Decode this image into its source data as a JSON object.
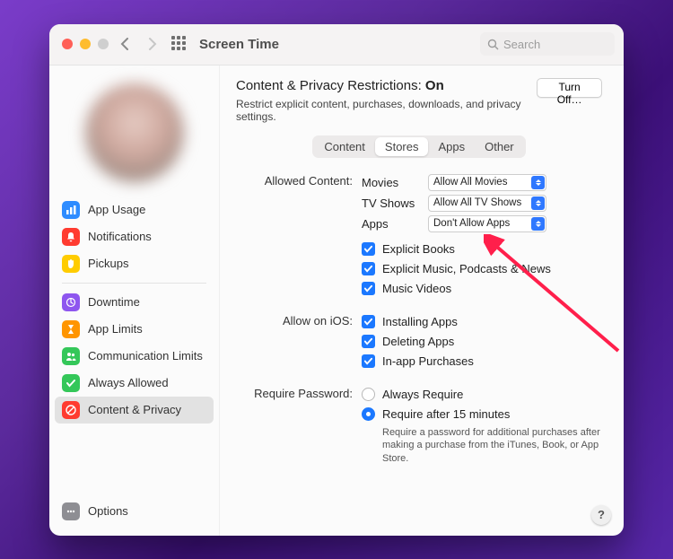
{
  "titlebar": {
    "title": "Screen Time",
    "search_placeholder": "Search"
  },
  "sidebar": {
    "items": [
      {
        "label": "App Usage",
        "icon_name": "bar-chart-icon",
        "color": "#2e8cff"
      },
      {
        "label": "Notifications",
        "icon_name": "bell-icon",
        "color": "#ff3b30"
      },
      {
        "label": "Pickups",
        "icon_name": "hand-icon",
        "color": "#ffcc00"
      }
    ],
    "items2": [
      {
        "label": "Downtime",
        "icon_name": "moon-icon",
        "color": "#8e56ef"
      },
      {
        "label": "App Limits",
        "icon_name": "hourglass-icon",
        "color": "#ff9500"
      },
      {
        "label": "Communication Limits",
        "icon_name": "people-icon",
        "color": "#34c759"
      },
      {
        "label": "Always Allowed",
        "icon_name": "check-icon",
        "color": "#34c759"
      },
      {
        "label": "Content & Privacy",
        "icon_name": "no-entry-icon",
        "color": "#ff3b30"
      }
    ],
    "options": "Options"
  },
  "header": {
    "title_prefix": "Content & Privacy Restrictions: ",
    "status": "On",
    "turn_off": "Turn Off…",
    "subtitle": "Restrict explicit content, purchases, downloads, and privacy settings."
  },
  "tabs": [
    {
      "label": "Content",
      "active": false
    },
    {
      "label": "Stores",
      "active": true
    },
    {
      "label": "Apps",
      "active": false
    },
    {
      "label": "Other",
      "active": false
    }
  ],
  "allowed_content": {
    "section_label": "Allowed Content:",
    "rows": [
      {
        "label": "Movies",
        "value": "Allow All Movies"
      },
      {
        "label": "TV Shows",
        "value": "Allow All TV Shows"
      },
      {
        "label": "Apps",
        "value": "Don't Allow Apps"
      }
    ],
    "checks": [
      "Explicit Books",
      "Explicit Music, Podcasts & News",
      "Music Videos"
    ]
  },
  "allow_on_ios": {
    "section_label": "Allow on iOS:",
    "checks": [
      "Installing Apps",
      "Deleting Apps",
      "In-app Purchases"
    ]
  },
  "require_password": {
    "section_label": "Require Password:",
    "radios": [
      {
        "label": "Always Require",
        "selected": false
      },
      {
        "label": "Require after 15 minutes",
        "selected": true
      }
    ],
    "help": "Require a password for additional purchases after making a purchase from the iTunes, Book, or App Store."
  },
  "help_button": "?"
}
